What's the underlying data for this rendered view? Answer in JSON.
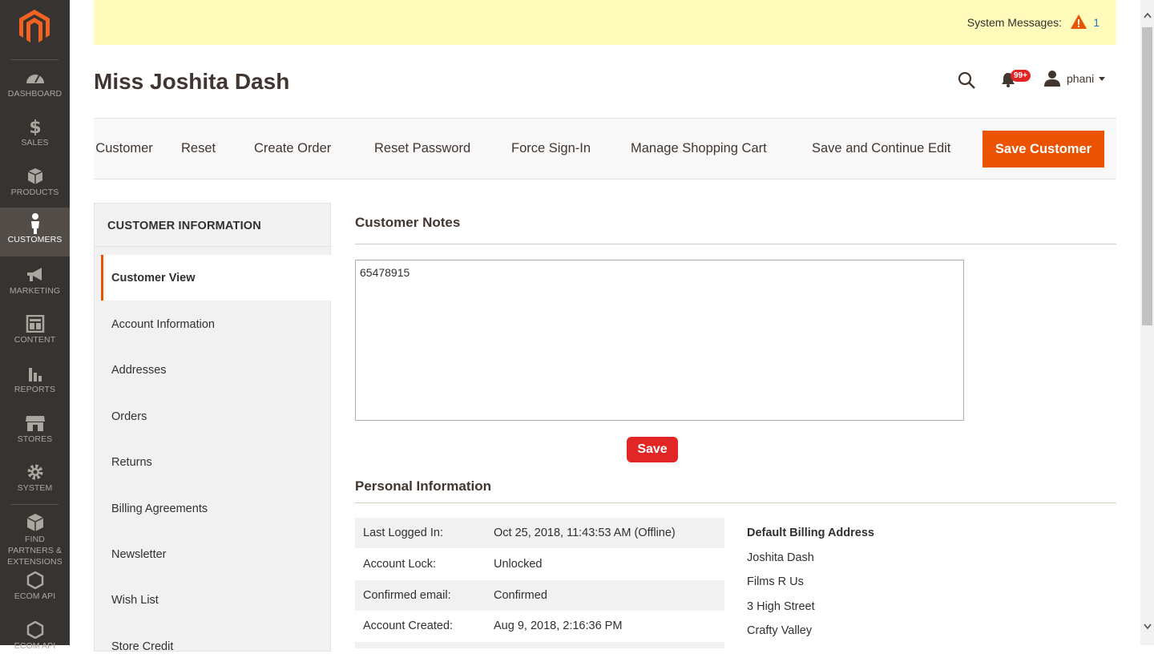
{
  "sidebar": {
    "items": [
      {
        "label": "DASHBOARD",
        "icon": "dashboard-icon"
      },
      {
        "label": "SALES",
        "icon": "dollar-icon"
      },
      {
        "label": "PRODUCTS",
        "icon": "box-icon"
      },
      {
        "label": "CUSTOMERS",
        "icon": "person-icon"
      },
      {
        "label": "MARKETING",
        "icon": "megaphone-icon"
      },
      {
        "label": "CONTENT",
        "icon": "layout-icon"
      },
      {
        "label": "REPORTS",
        "icon": "bar-chart-icon"
      },
      {
        "label": "STORES",
        "icon": "store-icon"
      },
      {
        "label": "SYSTEM",
        "icon": "gear-icon"
      },
      {
        "label": "FIND PARTNERS & EXTENSIONS",
        "icon": "extensions-icon"
      },
      {
        "label": "ECOM API",
        "icon": "hexagon-icon"
      },
      {
        "label": "ECOM API",
        "icon": "hexagon-icon"
      }
    ],
    "active": "CUSTOMERS"
  },
  "system_messages": {
    "label": "System Messages:",
    "count": "1"
  },
  "header": {
    "title": "Miss Joshita Dash",
    "notification_count": "99+",
    "user": "phani"
  },
  "actions": {
    "delete": "Delete Customer",
    "reset": "Reset",
    "create_order": "Create Order",
    "reset_password": "Reset Password",
    "force_signin": "Force Sign-In",
    "manage_cart": "Manage Shopping Cart",
    "save_continue": "Save and Continue Edit",
    "save_customer": "Save Customer"
  },
  "left_panel": {
    "title": "CUSTOMER INFORMATION",
    "items": [
      "Customer View",
      "Account Information",
      "Addresses",
      "Orders",
      "Returns",
      "Billing Agreements",
      "Newsletter",
      "Wish List",
      "Store Credit"
    ]
  },
  "notes": {
    "title": "Customer Notes",
    "value": "65478915",
    "save_label": "Save"
  },
  "personal_info": {
    "title": "Personal Information",
    "rows": [
      {
        "label": "Last Logged In:",
        "value": "Oct 25, 2018, 11:43:53 AM (Offline)"
      },
      {
        "label": "Account Lock:",
        "value": "Unlocked"
      },
      {
        "label": "Confirmed email:",
        "value": "Confirmed"
      },
      {
        "label": "Account Created:",
        "value": "Aug 9, 2018, 2:16:36 PM"
      }
    ],
    "billing_title": "Default Billing Address",
    "billing_lines": [
      "Joshita Dash",
      "Films R Us",
      "3 High Street",
      "Crafty Valley"
    ]
  },
  "colors": {
    "sidebar_bg": "#373330",
    "accent": "#eb5202",
    "save_red": "#e22626",
    "message_bg": "#fffbbb"
  }
}
